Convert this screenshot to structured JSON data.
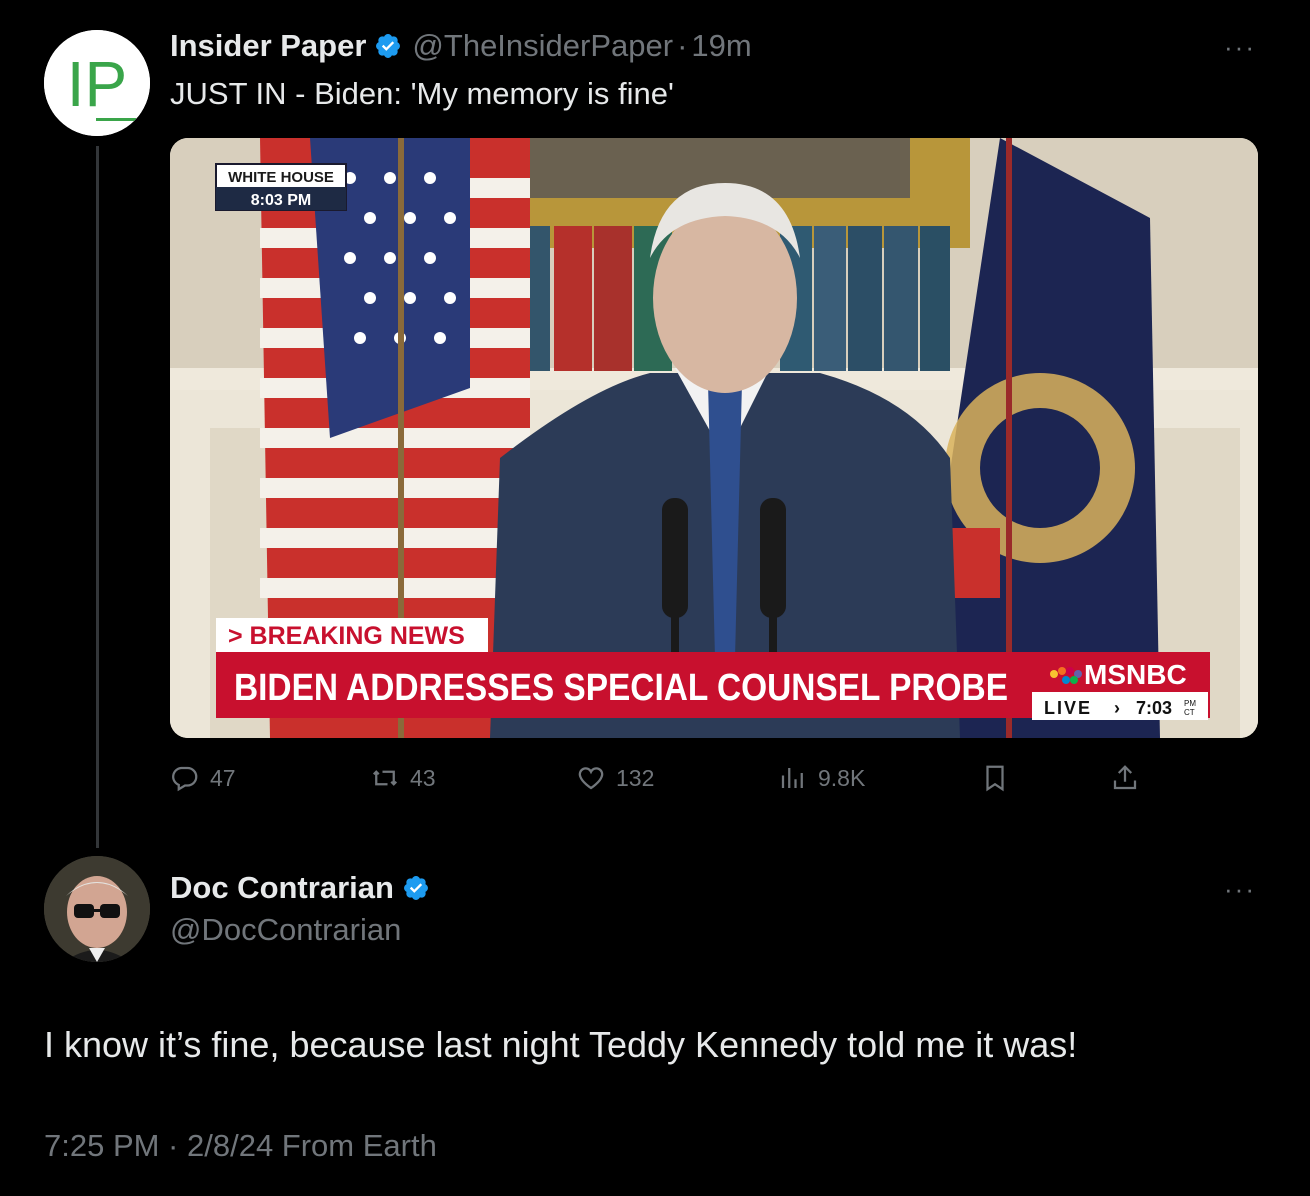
{
  "tweet": {
    "author_name": "Insider Paper",
    "handle": "@TheInsiderPaper",
    "separator": "·",
    "time": "19m",
    "text": "JUST IN - Biden: 'My memory is fine'",
    "avatar_text": "IP",
    "more": "···",
    "media": {
      "location_tag": "WHITE HOUSE",
      "clock": "8:03 PM",
      "breaking_label": "> BREAKING NEWS",
      "headline": "BIDEN ADDRESSES SPECIAL COUNSEL PROBE",
      "network": "MSNBC",
      "live_label": "LIVE",
      "live_arrow": "›",
      "live_time": "7:03",
      "live_ampm": "PM",
      "live_tz": "CT",
      "banner_color": "#c8102e"
    },
    "actions": {
      "replies": "47",
      "reposts": "43",
      "likes": "132",
      "views": "9.8K"
    }
  },
  "reply": {
    "author_name": "Doc Contrarian",
    "handle": "@DocContrarian",
    "more": "···",
    "text": "I know it’s fine, because last night Teddy Kennedy told me it was!",
    "meta": "7:25 PM · 2/8/24 From Earth"
  },
  "colors": {
    "verified": "#1d9bf0",
    "brand_green": "#3aa54a",
    "muted": "#71767b"
  },
  "icons": [
    "verified-icon",
    "reply-icon",
    "repost-icon",
    "like-icon",
    "views-icon",
    "bookmark-icon",
    "share-icon",
    "more-icon"
  ]
}
